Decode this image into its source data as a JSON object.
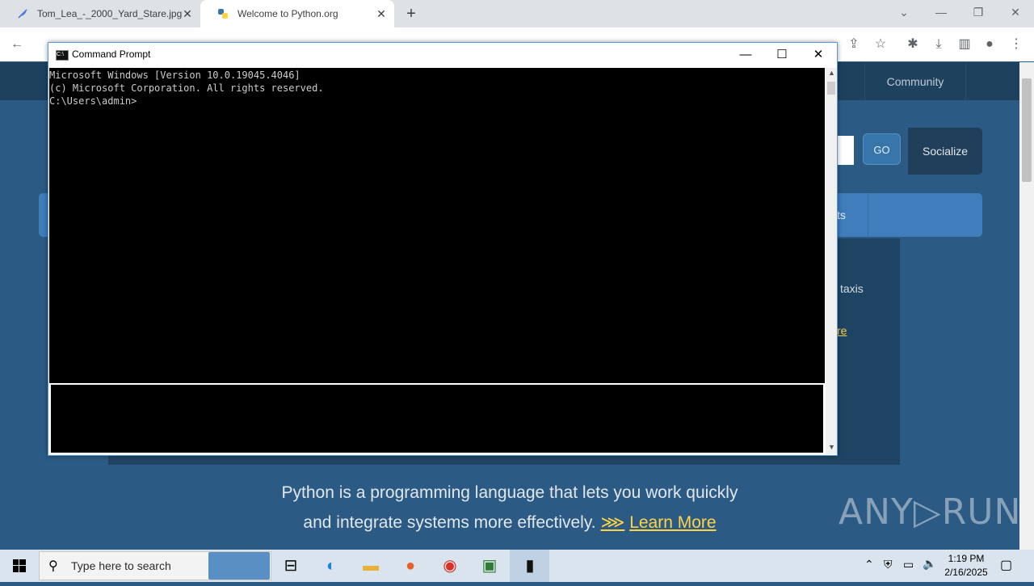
{
  "browser": {
    "tabs": [
      {
        "title": "Tom_Lea_-_2000_Yard_Stare.jpg"
      },
      {
        "title": "Welcome to Python.org"
      }
    ]
  },
  "site": {
    "nav_community": "Community",
    "go_label": "GO",
    "socialize_label": "Socialize",
    "bar_text_fragment": "ts",
    "panel_text_fragment": "taxis",
    "panel_link_fragment": "re",
    "tagline_line1": "Python is a programming language that lets you work quickly",
    "tagline_line2": "and integrate systems more effectively.",
    "learn_more_arrows": "⋙",
    "learn_more_label": "Learn More",
    "watermark": "ANY▷RUN"
  },
  "cmd": {
    "title": "Command Prompt",
    "line1": "Microsoft Windows [Version 10.0.19045.4046]",
    "line2": "(c) Microsoft Corporation. All rights reserved.",
    "line3": "",
    "prompt": "C:\\Users\\admin>"
  },
  "taskbar": {
    "search_placeholder": "Type here to search",
    "time": "1:19 PM",
    "date": "2/16/2025"
  }
}
